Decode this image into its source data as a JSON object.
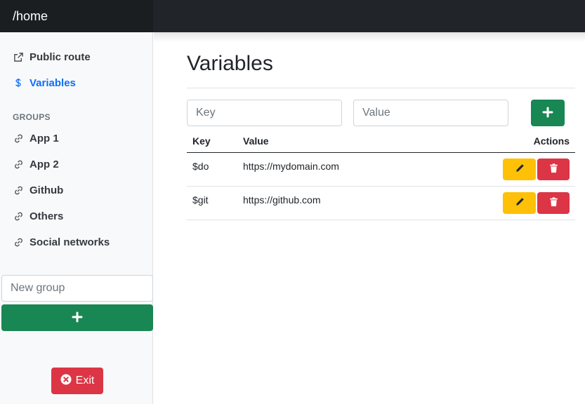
{
  "topbar": {
    "path": "/home"
  },
  "sidebar": {
    "links": [
      {
        "label": "Public route",
        "icon": "external-link-icon",
        "active": false
      },
      {
        "label": "Variables",
        "icon": "dollar-icon",
        "active": true
      }
    ],
    "groups_heading": "GROUPS",
    "groups": [
      {
        "label": "App 1",
        "icon": "link-icon"
      },
      {
        "label": "App 2",
        "icon": "link-icon"
      },
      {
        "label": "Github",
        "icon": "link-icon"
      },
      {
        "label": "Others",
        "icon": "link-icon"
      },
      {
        "label": "Social networks",
        "icon": "link-icon"
      }
    ],
    "new_group_placeholder": "New group",
    "add_group_icon": "plus-icon",
    "exit_label": "Exit",
    "exit_icon": "x-circle-icon"
  },
  "main": {
    "title": "Variables",
    "key_placeholder": "Key",
    "value_placeholder": "Value",
    "add_icon": "plus-icon",
    "table": {
      "columns": [
        "Key",
        "Value",
        "Actions"
      ],
      "rows": [
        {
          "key": "$do",
          "value": "https://mydomain.com"
        },
        {
          "key": "$git",
          "value": "https://github.com"
        }
      ],
      "edit_icon": "pencil-icon",
      "delete_icon": "trash-icon"
    }
  },
  "colors": {
    "topbar": "#212529",
    "brand": "#1b1e21",
    "active_link": "#0d6efd",
    "success": "#198754",
    "warning": "#ffc107",
    "danger": "#dc3545"
  }
}
